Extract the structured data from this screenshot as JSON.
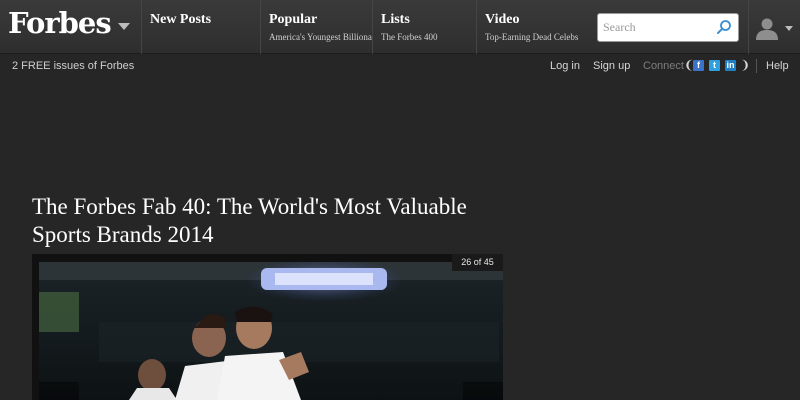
{
  "brand": {
    "name": "Forbes"
  },
  "nav": [
    {
      "title": "New Posts",
      "sub": ""
    },
    {
      "title": "Popular",
      "sub": "America's Youngest Billionaires"
    },
    {
      "title": "Lists",
      "sub": "The Forbes 400"
    },
    {
      "title": "Video",
      "sub": "Top-Earning Dead Celebs"
    }
  ],
  "search": {
    "placeholder": "Search",
    "value": ""
  },
  "subbar": {
    "promo": "2 FREE issues of Forbes",
    "login": "Log in",
    "signup": "Sign up",
    "connect": "Connect",
    "help": "Help",
    "social": {
      "facebook": "f",
      "twitter": "t",
      "linkedin": "in"
    }
  },
  "article": {
    "title": "The Forbes Fab 40: The World's Most Valuable Sports Brands 2014",
    "slide_counter": "26 of 45"
  },
  "colors": {
    "page_background": "#262626",
    "nav_background": "#333333",
    "accent_blue": "#2b87c9"
  },
  "icons": {
    "logo_menu": "chevron-down-icon",
    "search": "search-icon",
    "user": "user-icon"
  }
}
